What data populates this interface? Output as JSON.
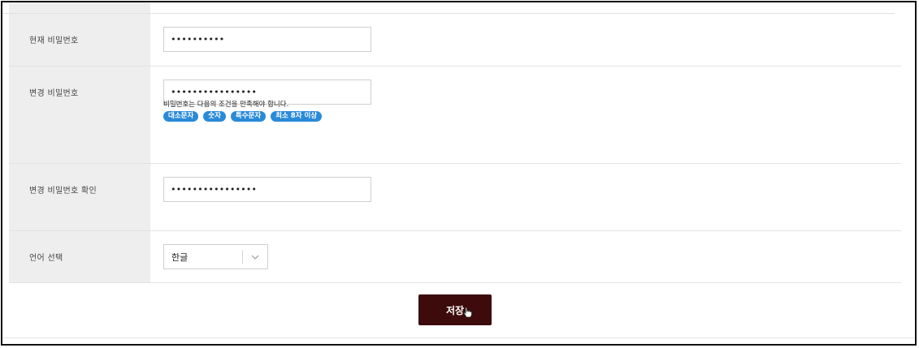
{
  "form": {
    "current_password": {
      "label": "현재 비밀번호",
      "value": "••••••••••"
    },
    "new_password": {
      "label": "변경 비밀번호",
      "value": "••••••••••••••••",
      "hint": "비밀번호는 다음의 조건을 만족해야 합니다.",
      "requirements": [
        "대소문자",
        "숫자",
        "특수문자",
        "최소 8자 이상"
      ]
    },
    "confirm_password": {
      "label": "변경 비밀번호 확인",
      "value": "••••••••••••••••"
    },
    "language": {
      "label": "언어 선택",
      "selected": "한글",
      "icon": "chevron-down-icon"
    }
  },
  "actions": {
    "save_label": "저장"
  },
  "colors": {
    "chip": "#2a8ad8",
    "save_button": "#3d0b0b",
    "label_bg": "#eeeeee"
  }
}
